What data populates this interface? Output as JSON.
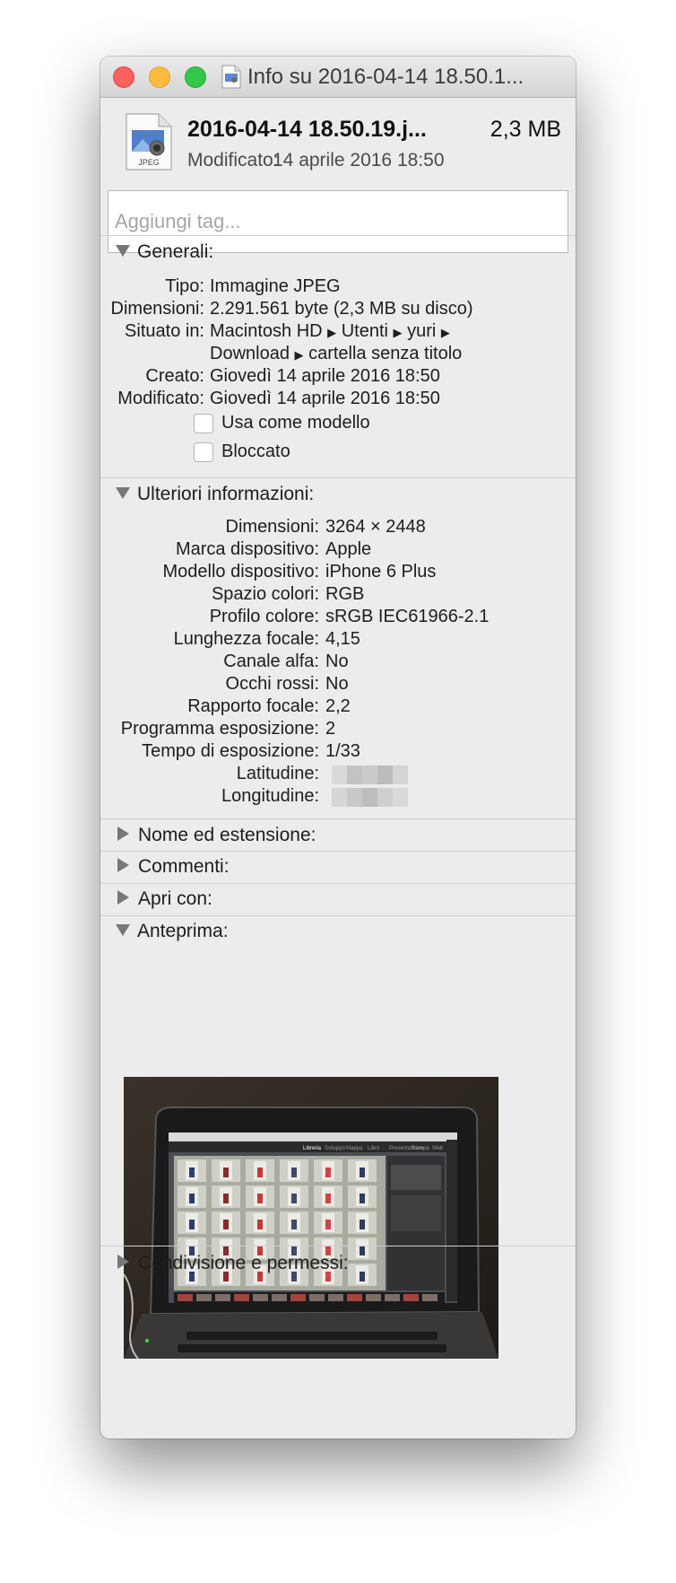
{
  "window": {
    "title": "Info su 2016-04-14 18.50.1..."
  },
  "header": {
    "filename": "2016-04-14 18.50.19.j...",
    "size": "2,3 MB",
    "modified_label": "Modificato:",
    "modified_value": "14 aprile 2016 18:50",
    "icon_label": "JPEG"
  },
  "tags": {
    "placeholder": "Aggiungi tag..."
  },
  "general": {
    "title": "Generali:",
    "rows": [
      {
        "label": "Tipo:",
        "value": "Immagine JPEG"
      },
      {
        "label": "Dimensioni:",
        "value": "2.291.561 byte (2,3 MB su disco)"
      },
      {
        "label": "Situato in:",
        "path1": [
          "Macintosh HD",
          "Utenti",
          "yuri"
        ],
        "path2": [
          "Download",
          "cartella senza titolo"
        ]
      },
      {
        "label": "Creato:",
        "value": "Giovedì 14 aprile 2016 18:50"
      },
      {
        "label": "Modificato:",
        "value": "Giovedì 14 aprile 2016 18:50"
      }
    ],
    "template_label": "Usa come modello",
    "locked_label": "Bloccato",
    "template_checked": false,
    "locked_checked": false
  },
  "more_info": {
    "title": "Ulteriori informazioni:",
    "rows": [
      {
        "label": "Dimensioni:",
        "value": "3264 × 2448"
      },
      {
        "label": "Marca dispositivo:",
        "value": "Apple"
      },
      {
        "label": "Modello dispositivo:",
        "value": "iPhone 6 Plus"
      },
      {
        "label": "Spazio colori:",
        "value": "RGB"
      },
      {
        "label": "Profilo colore:",
        "value": "sRGB IEC61966-2.1"
      },
      {
        "label": "Lunghezza focale:",
        "value": "4,15"
      },
      {
        "label": "Canale alfa:",
        "value": "No"
      },
      {
        "label": "Occhi rossi:",
        "value": "No"
      },
      {
        "label": "Rapporto focale:",
        "value": "2,2"
      },
      {
        "label": "Programma esposizione:",
        "value": "2"
      },
      {
        "label": "Tempo di esposizione:",
        "value": "1/33"
      },
      {
        "label": "Latitudine:",
        "value": ""
      },
      {
        "label": "Longitudine:",
        "value": ""
      }
    ]
  },
  "collapsed_sections": {
    "name_ext": "Nome ed estensione:",
    "comments": "Commenti:",
    "open_with": "Apri con:"
  },
  "preview": {
    "title": "Anteprima:",
    "screen_tabs": [
      "Libreria",
      "Sviluppo",
      "Mappa",
      "Libro",
      "Presentazione",
      "Stampa",
      "Web"
    ]
  },
  "sharing": {
    "title": "Condivisione e permessi:"
  },
  "colors": {
    "window_bg": "#ececec",
    "close": "#fc615d",
    "minimize": "#fdbc40",
    "maximize": "#34c84a"
  }
}
